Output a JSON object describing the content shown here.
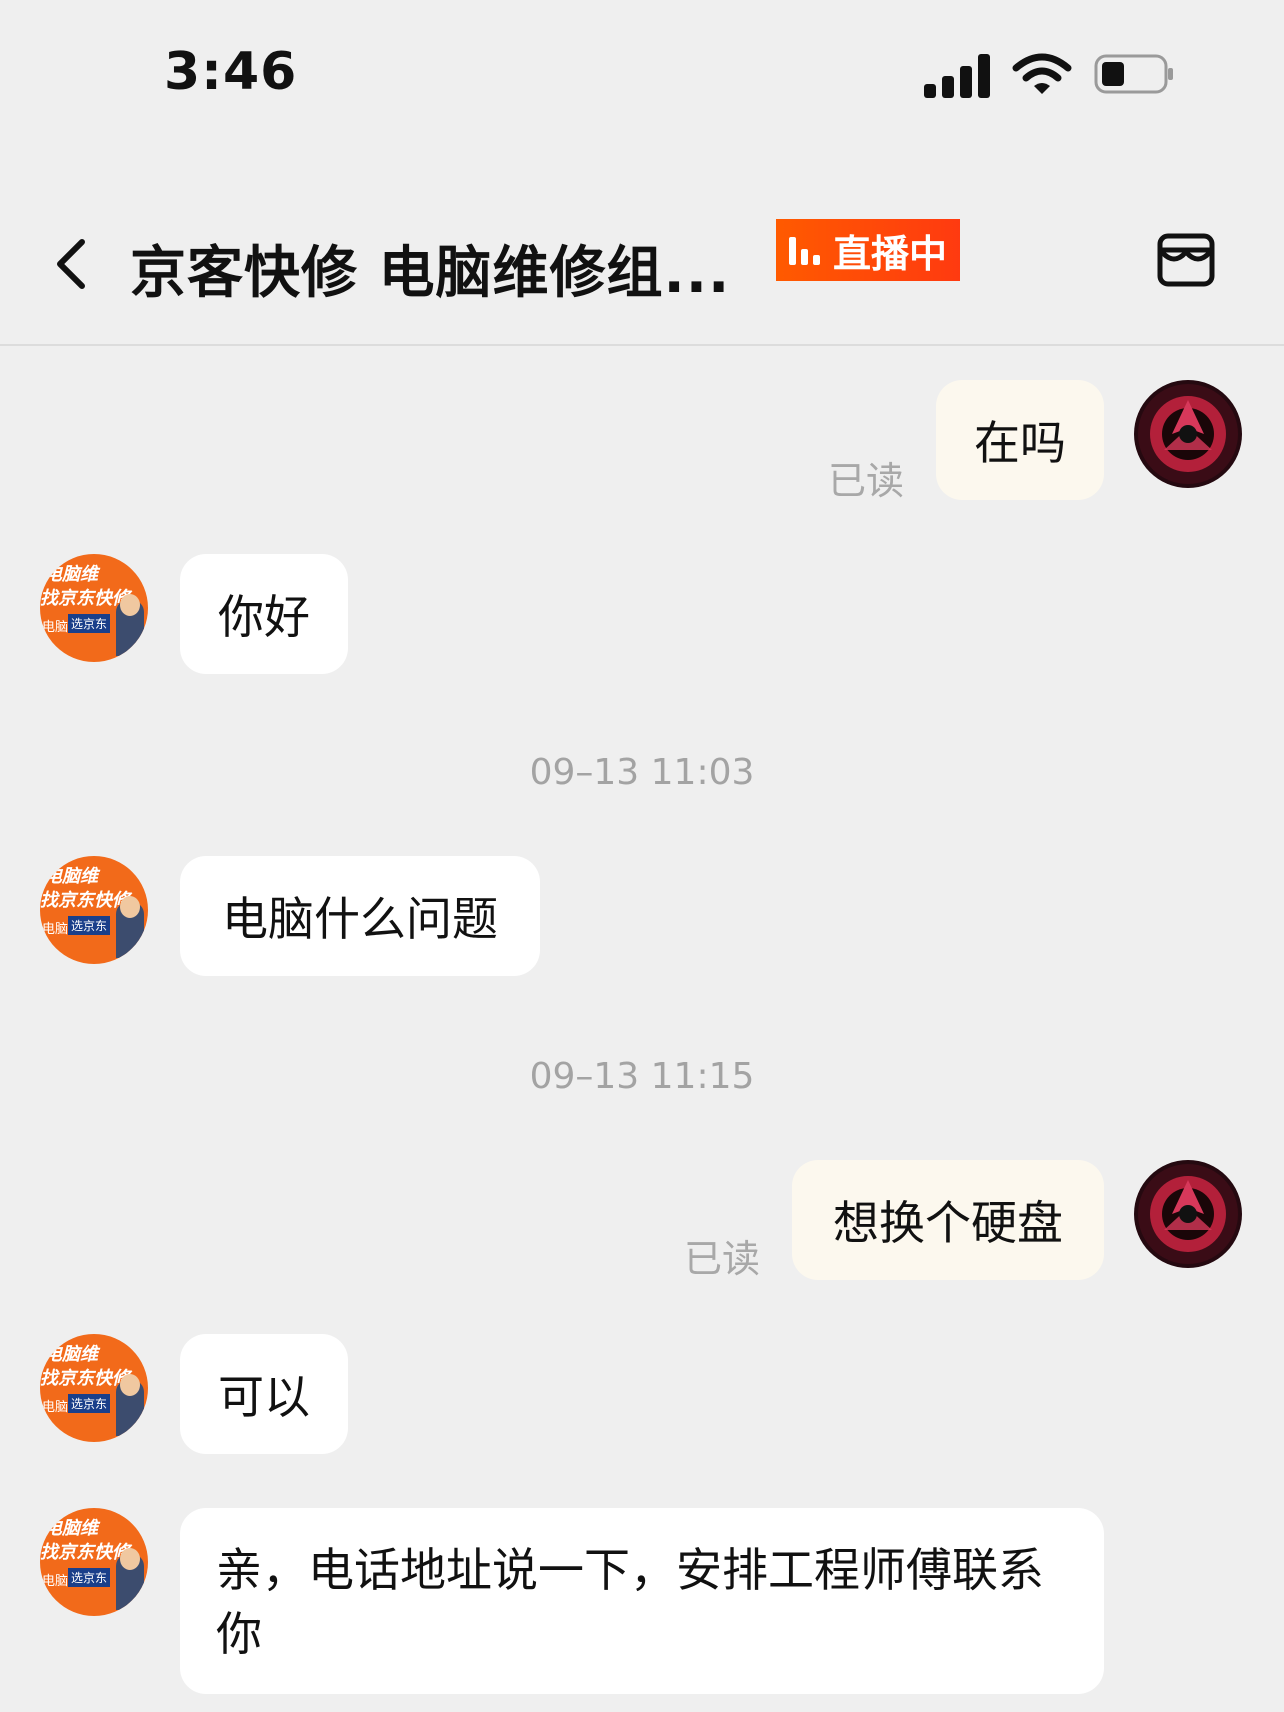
{
  "status_bar": {
    "time": "3:46"
  },
  "header": {
    "title": "京客快修 电脑维修组...",
    "live_badge": "直播中"
  },
  "messages": [
    {
      "from": "self",
      "text": "在吗",
      "read": "已读"
    },
    {
      "from": "shop",
      "text": "你好"
    },
    {
      "timestamp": "09–13 11:03"
    },
    {
      "from": "shop",
      "text": "电脑什么问题"
    },
    {
      "timestamp": "09–13 11:15"
    },
    {
      "from": "self",
      "text": "想换个硬盘",
      "read": "已读"
    },
    {
      "from": "shop",
      "text": "可以"
    },
    {
      "from": "shop",
      "text": "亲，电话地址说一下，安排工程师傅联系你"
    }
  ],
  "avatar_text": {
    "line1": "电脑维",
    "line2": "找京东快修",
    "line3": "电脑",
    "badge": "选京东"
  },
  "colors": {
    "live_badge": "#ff4d0a",
    "background": "#efefef",
    "self_bubble": "#fcf8ee",
    "shop_bubble": "#ffffff",
    "shop_avatar": "#f26a1a",
    "self_avatar": "#5b1420"
  },
  "icons": {
    "back": "chevron-left-icon",
    "shop": "store-icon",
    "signal": "cellular-signal-icon",
    "wifi": "wifi-icon",
    "battery": "battery-icon"
  }
}
